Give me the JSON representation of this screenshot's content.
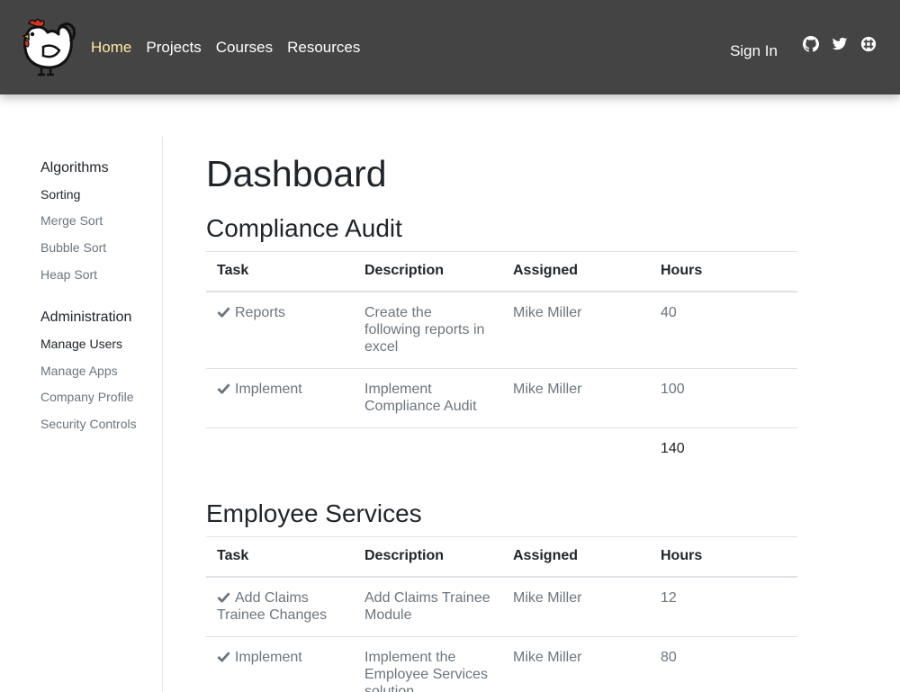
{
  "nav": {
    "logo_name": "chicken-logo",
    "links": [
      {
        "label": "Home",
        "active": true
      },
      {
        "label": "Projects",
        "active": false
      },
      {
        "label": "Courses",
        "active": false
      },
      {
        "label": "Resources",
        "active": false
      }
    ],
    "sign_in": "Sign In",
    "social_icons": [
      "github-icon",
      "twitter-icon",
      "slack-icon"
    ]
  },
  "sidebar": {
    "groups": [
      {
        "heading": "Algorithms",
        "items": [
          "Sorting",
          "Merge Sort",
          "Bubble Sort",
          "Heap Sort"
        ]
      },
      {
        "heading": "Administration",
        "items": [
          "Manage Users",
          "Manage Apps",
          "Company Profile",
          "Security Controls"
        ]
      }
    ]
  },
  "main": {
    "title": "Dashboard",
    "columns": [
      "Task",
      "Description",
      "Assigned",
      "Hours"
    ],
    "sections": [
      {
        "title": "Compliance Audit",
        "rows": [
          {
            "task": "Reports",
            "description": "Create the following reports in excel",
            "assigned": "Mike Miller",
            "hours": "40"
          },
          {
            "task": "Implement",
            "description": "Implement Compliance Audit",
            "assigned": "Mike Miller",
            "hours": "100"
          }
        ],
        "total": "140"
      },
      {
        "title": "Employee Services",
        "rows": [
          {
            "task": "Add Claims Trainee Changes",
            "description": "Add Claims Trainee Module",
            "assigned": "Mike Miller",
            "hours": "12"
          },
          {
            "task": "Implement",
            "description": "Implement the Employee Services solution",
            "assigned": "Mike Miller",
            "hours": "80"
          }
        ]
      }
    ]
  },
  "colors": {
    "navbar_bg": "#444444",
    "nav_active": "#ffe8a6",
    "text_muted": "#6c757d",
    "text_dark": "#212529",
    "table_border": "#dee2e6"
  }
}
